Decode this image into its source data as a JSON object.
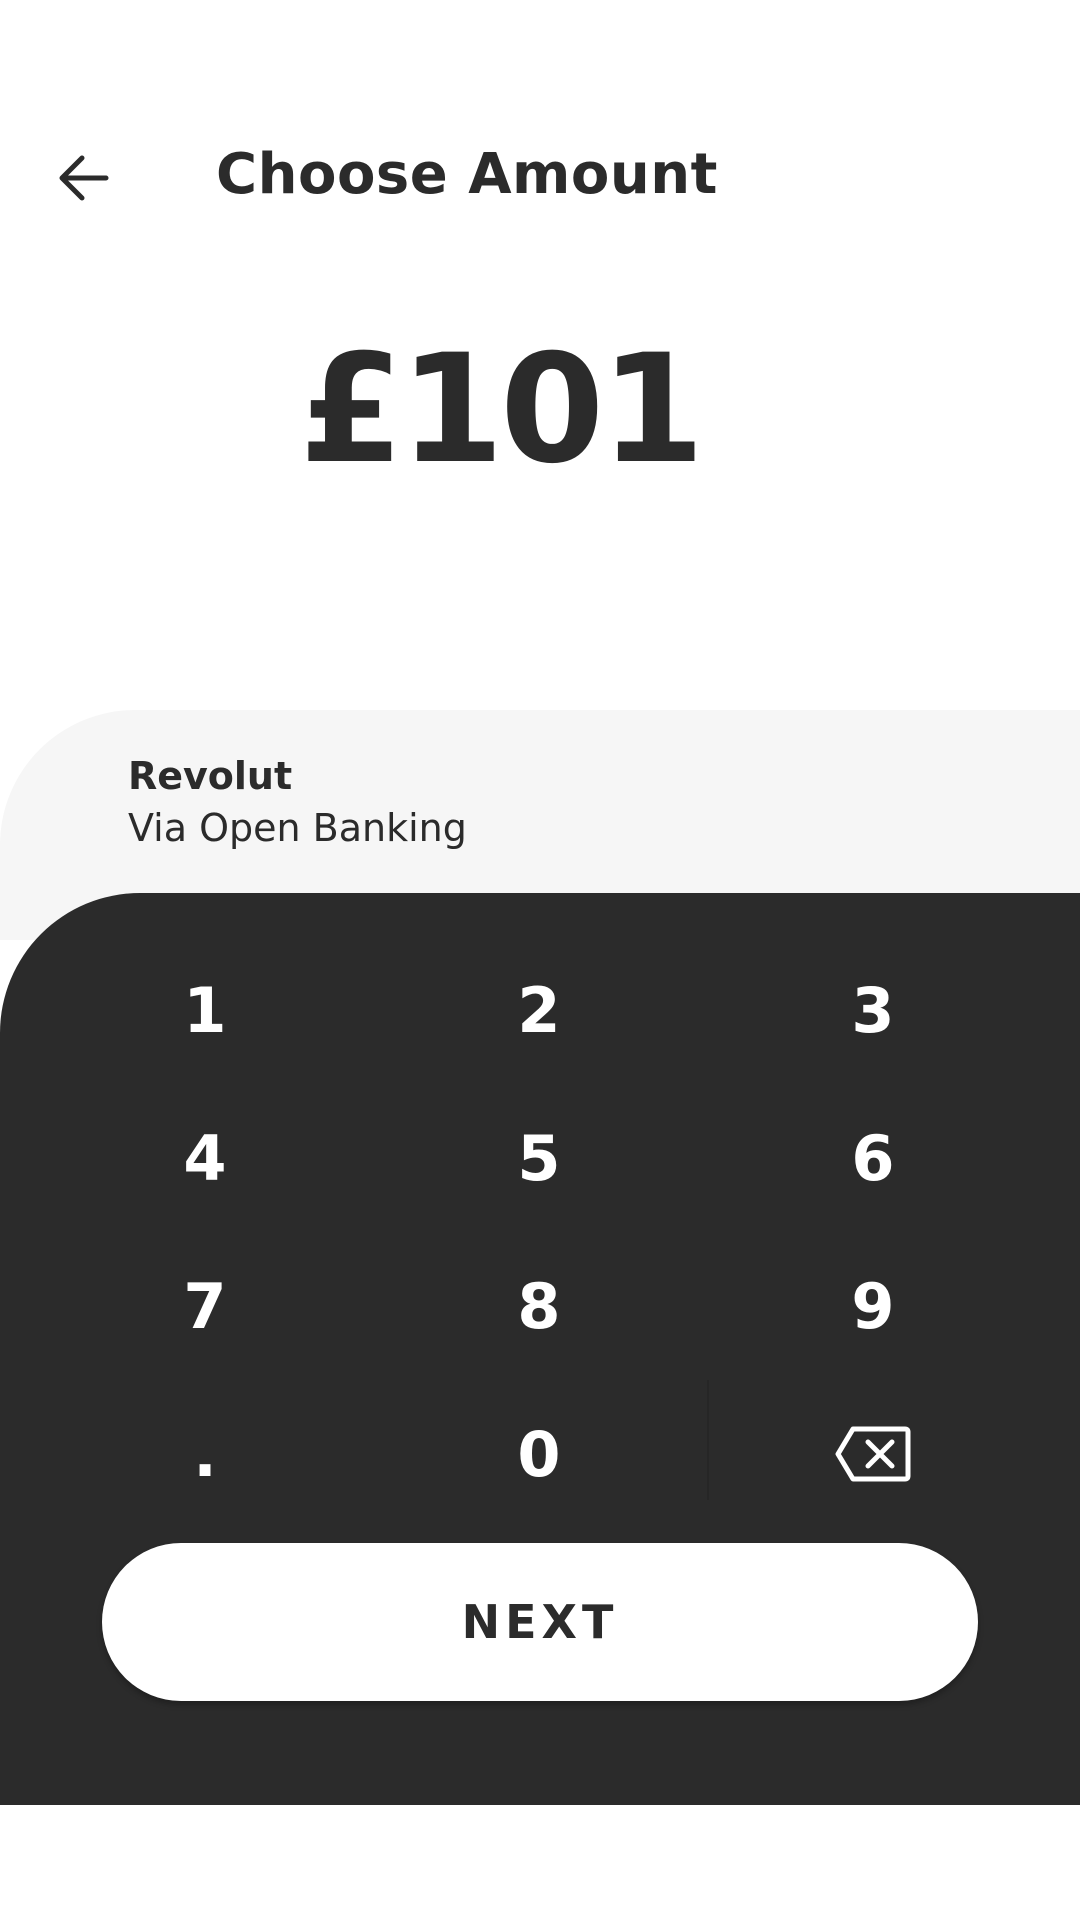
{
  "header": {
    "back_icon": "arrow-left-icon",
    "title": "Choose Amount"
  },
  "amount": {
    "display": "£101"
  },
  "payment_method": {
    "name": "Revolut",
    "via": "Via Open Banking"
  },
  "keypad": {
    "keys": [
      "1",
      "2",
      "3",
      "4",
      "5",
      "6",
      "7",
      "8",
      "9",
      ".",
      "0"
    ],
    "backspace_icon": "backspace-icon"
  },
  "next_button": {
    "label": "NEXT"
  },
  "colors": {
    "text": "#2b2b2b",
    "panel_light": "#f6f6f6",
    "keypad_bg": "#2b2b2b",
    "button_bg": "#ffffff"
  }
}
